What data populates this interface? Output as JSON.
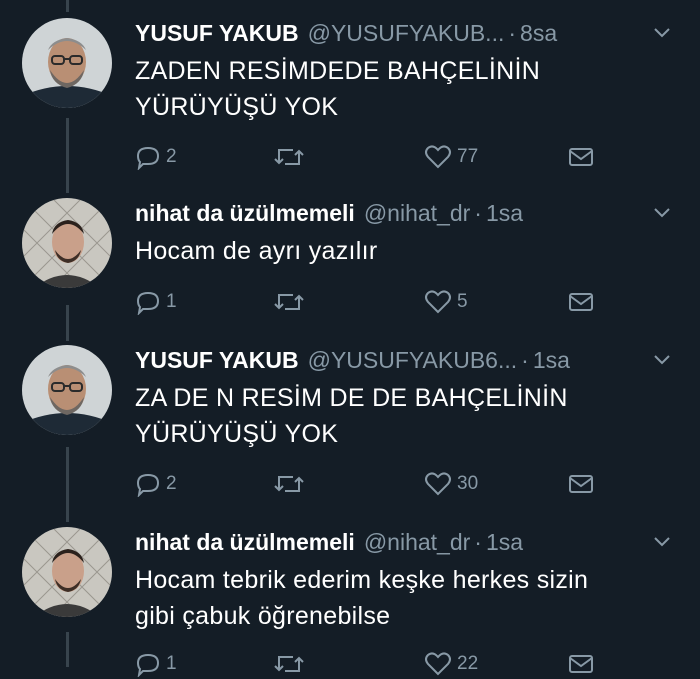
{
  "tweets": [
    {
      "name": "YUSUF YAKUB",
      "handle": "@YUSUFYAKUB...",
      "dot": "·",
      "time": "8sa",
      "text_lines": [
        "ZADEN RESİMDEDE BAHÇELİNİN",
        "YÜRÜYÜŞÜ YOK"
      ],
      "replies": "2",
      "retweets": "",
      "likes": "77",
      "avatar": "older-man-glasses-beard"
    },
    {
      "name": "nihat da üzülmemeli",
      "handle": "@nihat_dr",
      "dot": "·",
      "time": "1sa",
      "text_lines": [
        "Hocam de ayrı yazılır"
      ],
      "replies": "1",
      "retweets": "",
      "likes": "5",
      "avatar": "young-man-selfie"
    },
    {
      "name": "YUSUF YAKUB",
      "handle": "@YUSUFYAKUB6...",
      "dot": "·",
      "time": "1sa",
      "text_lines": [
        "ZA DE N RESİM DE DE BAHÇELİNİN",
        "YÜRÜYÜŞÜ YOK"
      ],
      "replies": "2",
      "retweets": "",
      "likes": "30",
      "avatar": "older-man-glasses-beard"
    },
    {
      "name": "nihat da üzülmemeli",
      "handle": "@nihat_dr",
      "dot": "·",
      "time": "1sa",
      "text_lines": [
        "Hocam tebrik ederim keşke herkes sizin",
        "gibi çabuk öğrenebilse"
      ],
      "replies": "1",
      "retweets": "",
      "likes": "22",
      "avatar": "young-man-selfie"
    }
  ],
  "colors": {
    "background": "#141d26",
    "text": "#ffffff",
    "muted": "#8899a6",
    "thread_line": "#38444d"
  }
}
